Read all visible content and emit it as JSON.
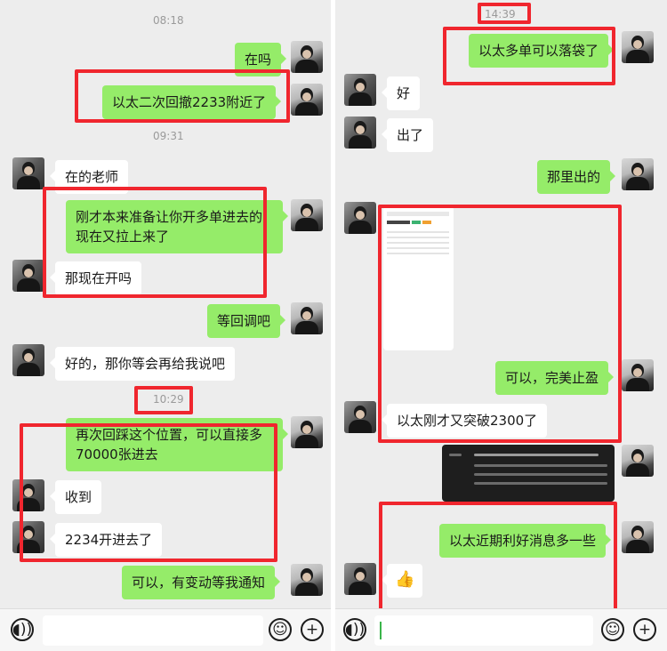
{
  "left": {
    "time1": "08:18",
    "time2": "09:31",
    "time3": "10:29",
    "messages": [
      {
        "text": "在吗"
      },
      {
        "text": "以太二次回撤2233附近了"
      },
      {
        "text": "在的老师"
      },
      {
        "text": "刚才本来准备让你开多单进去的现在又拉上来了"
      },
      {
        "text": "那现在开吗"
      },
      {
        "text": "等回调吧"
      },
      {
        "text": "好的，那你等会再给我说吧"
      },
      {
        "text": "再次回踩这个位置，可以直接多70000张进去"
      },
      {
        "text": "收到"
      },
      {
        "text": "2234开进去了"
      },
      {
        "text": "可以，有变动等我通知"
      }
    ]
  },
  "right": {
    "time1": "14:39",
    "messages": [
      {
        "text": "以太多单可以落袋了"
      },
      {
        "text": "好"
      },
      {
        "text": "出了"
      },
      {
        "text": "那里出的"
      },
      {
        "text": "可以，完美止盈"
      },
      {
        "text": "以太刚才又突破2300了"
      },
      {
        "text": "以太近期利好消息多一些"
      },
      {
        "text": "👍"
      }
    ]
  },
  "icons": {
    "voice": "voice-icon",
    "emoji": "emoji-icon",
    "plus": "plus-icon",
    "thumbs_up": "thumbs-up-icon"
  },
  "colors": {
    "sent_bubble": "#95ec69",
    "received_bubble": "#ffffff",
    "highlight_box": "#f0262e",
    "chat_background": "#ededed"
  }
}
